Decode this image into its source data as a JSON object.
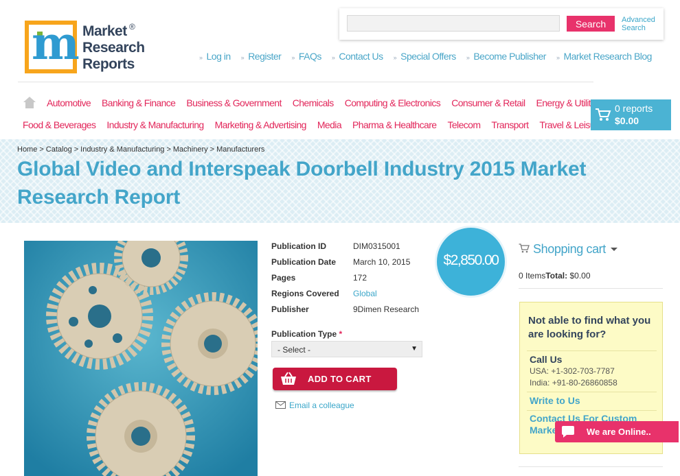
{
  "logo": {
    "line1": "Market",
    "line2": "Research",
    "line3": "Reports",
    "reg": "®"
  },
  "search": {
    "placeholder": "",
    "button": "Search",
    "advanced": "Advanced Search"
  },
  "top_links": [
    "Log in",
    "Register",
    "FAQs",
    "Contact Us",
    "Special Offers",
    "Become Publisher",
    "Market Research Blog"
  ],
  "categories_row1": [
    "Automotive",
    "Banking & Finance",
    "Business & Government",
    "Chemicals",
    "Computing & Electronics",
    "Consumer & Retail",
    "Energy & Utilities"
  ],
  "categories_row2": [
    "Food & Beverages",
    "Industry & Manufacturing",
    "Marketing & Advertising",
    "Media",
    "Pharma & Healthcare",
    "Telecom",
    "Transport",
    "Travel & Leisure"
  ],
  "cart": {
    "count": "0 reports",
    "total": "$0.00"
  },
  "breadcrumb": [
    "Home",
    "Catalog",
    "Industry & Manufacturing",
    "Machinery",
    "Manufacturers"
  ],
  "breadcrumb_sep": ">",
  "title": "Global Video and Interspeak Doorbell Industry 2015 Market Research Report",
  "product": {
    "publication_id_label": "Publication ID",
    "publication_id": "DIM0315001",
    "publication_date_label": "Publication Date",
    "publication_date": "March 10, 2015",
    "pages_label": "Pages",
    "pages": "172",
    "regions_label": "Regions Covered",
    "regions": "Global",
    "publisher_label": "Publisher",
    "publisher": "9Dimen Research",
    "pub_type_label": "Publication Type",
    "required_mark": "*",
    "select_value": "- Select -",
    "add_to_cart": "ADD TO CART",
    "email_colleague": "Email a colleague",
    "price": "$2,850.00"
  },
  "sidebar": {
    "shopping_cart": "Shopping cart",
    "items_text": "0 Items",
    "total_label": "Total:",
    "total_value": "$0.00",
    "help_title": "Not able to find what you are looking for?",
    "call_us": "Call Us",
    "phone_usa": "USA: +1-302-703-7787",
    "phone_india": "India: +91-80-26860858",
    "write_to_us": "Write to Us",
    "contact_custom": "Contact Us For Custom",
    "contact_custom_2": "Market"
  },
  "chat": {
    "label": "We are Online.."
  },
  "colors": {
    "accent_pink": "#e2265a",
    "accent_blue": "#43a5c9",
    "cart_blue": "#4bb3d3",
    "add_cart_red": "#c9183f"
  },
  "icons": [
    "home-icon",
    "cart-icon",
    "email-icon",
    "chat-icon",
    "chevron-down-icon"
  ]
}
